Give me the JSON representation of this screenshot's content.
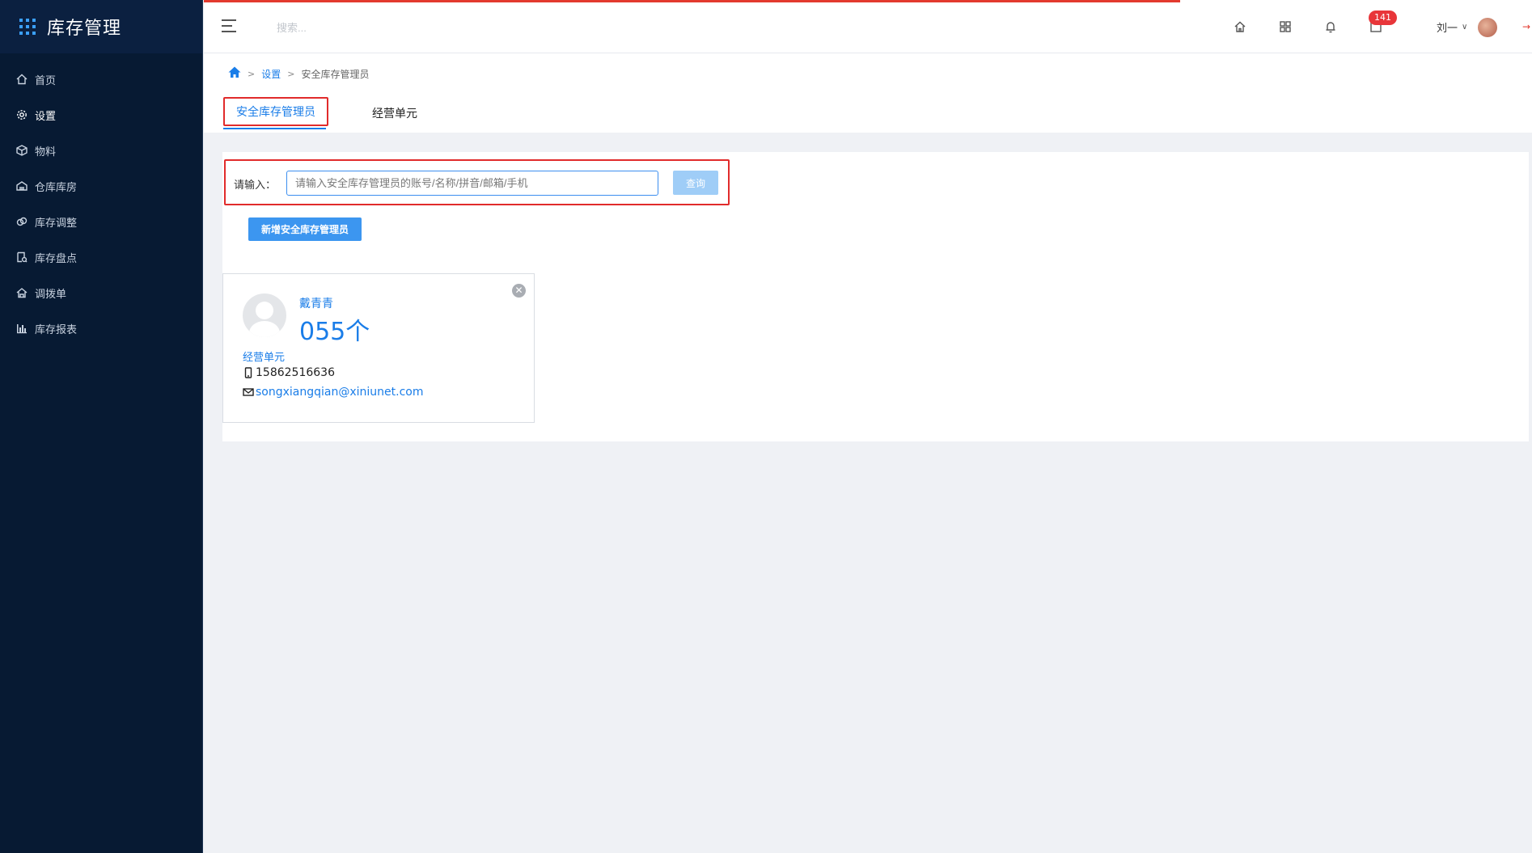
{
  "app": {
    "title": "库存管理"
  },
  "sidebar": {
    "items": [
      {
        "label": "首页",
        "icon": "home-icon"
      },
      {
        "label": "设置",
        "icon": "gear-icon"
      },
      {
        "label": "物料",
        "icon": "cube-icon"
      },
      {
        "label": "仓库库房",
        "icon": "warehouse-icon"
      },
      {
        "label": "库存调整",
        "icon": "adjust-icon"
      },
      {
        "label": "库存盘点",
        "icon": "inventory-check-icon"
      },
      {
        "label": "调拨单",
        "icon": "transfer-icon"
      },
      {
        "label": "库存报表",
        "icon": "bar-chart-icon"
      }
    ],
    "active_index": 1
  },
  "topbar": {
    "search_placeholder": "搜索...",
    "badge_count": "141",
    "user_name": "刘一"
  },
  "breadcrumb": {
    "items": [
      "设置",
      "安全库存管理员"
    ]
  },
  "tabs": [
    {
      "label": "安全库存管理员",
      "active": true
    },
    {
      "label": "经营单元",
      "active": false
    }
  ],
  "search_form": {
    "label": "请输入：",
    "placeholder": "请输入安全库存管理员的账号/名称/拼音/邮箱/手机",
    "query_button": "查询"
  },
  "add_button": "新增安全库存管理员",
  "cards": [
    {
      "name": "戴青青",
      "count": "055个",
      "unit_link": "经营单元",
      "phone": "15862516636",
      "email": "songxiangqian@xiniunet.com"
    }
  ],
  "colors": {
    "sidebar_bg": "#071a33",
    "accent": "#1a7de8",
    "highlight_border": "#e12b2b",
    "badge": "#e8363a"
  }
}
